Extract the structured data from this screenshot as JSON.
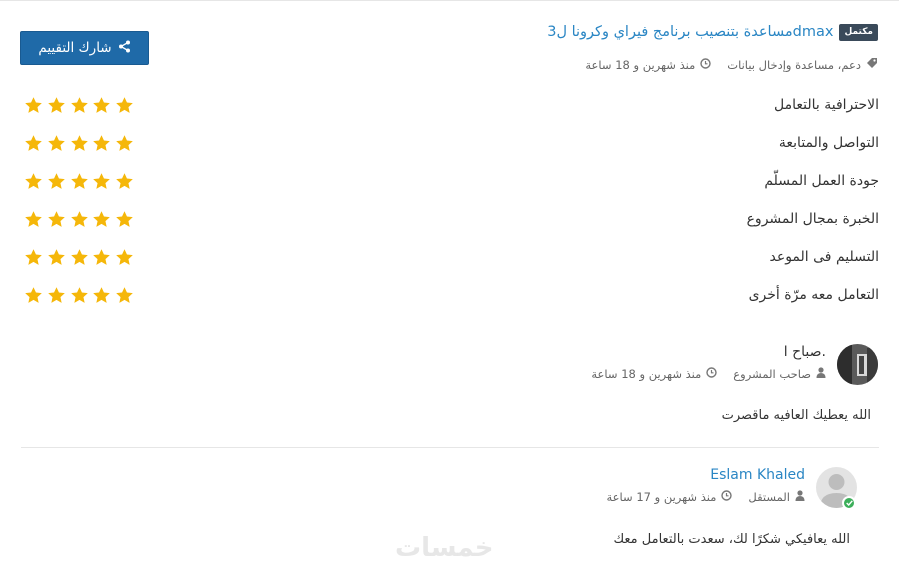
{
  "project": {
    "status_badge": "مكتمل",
    "title": "مساعدة بتنصيب برنامج فيراي وكرونا ل3dmax",
    "category": "دعم، مساعدة وإدخال بيانات",
    "time": "منذ شهرين و 18 ساعة"
  },
  "share_button": {
    "label": "شارك التقييم"
  },
  "ratings": [
    {
      "label": "الاحترافية بالتعامل",
      "stars": 5
    },
    {
      "label": "التواصل والمتابعة",
      "stars": 5
    },
    {
      "label": "جودة العمل المسلّم",
      "stars": 5
    },
    {
      "label": "الخبرة بمجال المشروع",
      "stars": 5
    },
    {
      "label": "التسليم فى الموعد",
      "stars": 5
    },
    {
      "label": "التعامل معه مرّة أخرى",
      "stars": 5
    }
  ],
  "comments": [
    {
      "author": "صباح ا.",
      "role": "صاحب المشروع",
      "time": "منذ شهرين و 18 ساعة",
      "text": "الله يعطيك العافيه ماقصرت"
    },
    {
      "author": "Eslam Khaled",
      "role": "المستقل",
      "time": "منذ شهرين و 17 ساعة",
      "text": "الله يعافيكي شكرًا لك، سعدت بالتعامل معك"
    }
  ],
  "watermark": "خمسات",
  "colors": {
    "accent": "#2a86c4",
    "button": "#1f6aa8",
    "star": "#f5b70a",
    "badge": "#3a4a5a",
    "verified": "#3caf5a"
  },
  "icons": [
    "share-icon",
    "tags-icon",
    "clock-icon",
    "user-icon",
    "star-icon",
    "verified-check-icon"
  ]
}
